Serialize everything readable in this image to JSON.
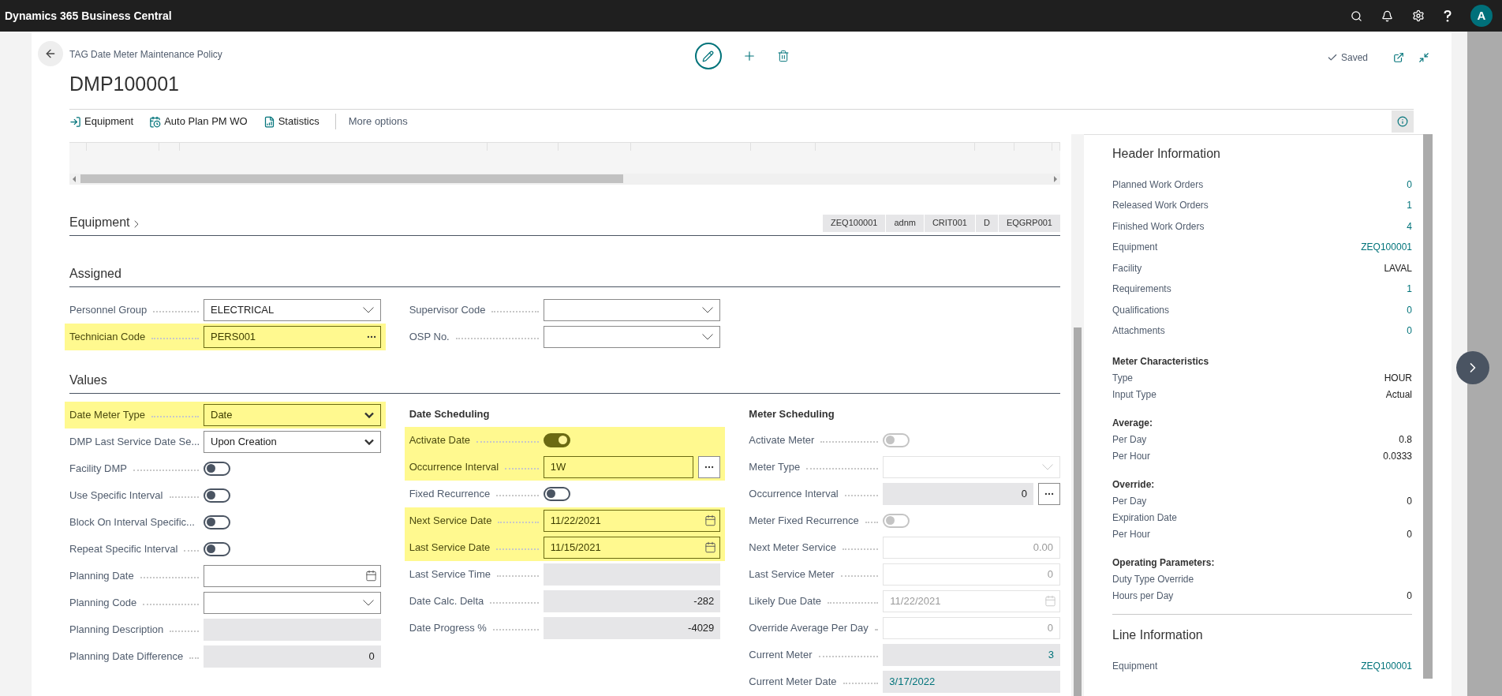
{
  "app_bar": {
    "title": "Dynamics 365 Business Central",
    "avatar": "A"
  },
  "page": {
    "breadcrumb": "TAG Date Meter Maintenance Policy",
    "title": "DMP100001",
    "status": "Saved"
  },
  "actions": [
    {
      "label": "Equipment",
      "kind": "equipment"
    },
    {
      "label": "Auto Plan PM WO",
      "kind": "plan"
    },
    {
      "label": "Statistics",
      "kind": "statistics"
    },
    {
      "label": "More options",
      "kind": "more"
    }
  ],
  "equipment_section": {
    "title": "Equipment",
    "tags": [
      "ZEQ100001",
      "adnm",
      "CRIT001",
      "D",
      "EQGRP001"
    ]
  },
  "assigned": {
    "title": "Assigned",
    "columns": [
      {
        "fields": [
          {
            "label": "Personnel Group",
            "kind": "combo",
            "value": "ELECTRICAL",
            "highlighted": false,
            "disabled": false
          },
          {
            "label": "Technician Code",
            "kind": "lookup",
            "value": "PERS001",
            "highlighted": true,
            "disabled": false
          }
        ]
      },
      {
        "fields": [
          {
            "label": "Supervisor Code",
            "kind": "combo",
            "highlighted": false,
            "disabled": false
          },
          {
            "label": "OSP No.",
            "kind": "combo",
            "highlighted": false,
            "disabled": false
          }
        ]
      }
    ]
  },
  "values": {
    "title": "Values",
    "columns": [
      {
        "fields": [
          {
            "label": "Date Meter Type",
            "kind": "select",
            "value": "Date",
            "highlighted": true,
            "disabled": false
          },
          {
            "label": "DMP Last Service Date Se...",
            "kind": "select",
            "value": "Upon Creation",
            "highlighted": false,
            "disabled": false
          },
          {
            "label": "Facility DMP",
            "kind": "toggle",
            "on": false,
            "highlighted": false,
            "disabled": false
          },
          {
            "label": "Use Specific Interval",
            "kind": "toggle",
            "on": false,
            "highlighted": false,
            "disabled": false
          },
          {
            "label": "Block On Interval Specific...",
            "kind": "toggle",
            "on": false,
            "highlighted": false,
            "disabled": false
          },
          {
            "label": "Repeat Specific Interval",
            "kind": "toggle",
            "on": false,
            "highlighted": false,
            "disabled": false
          },
          {
            "label": "Planning Date",
            "kind": "date",
            "highlighted": false,
            "disabled": false
          },
          {
            "label": "Planning Code",
            "kind": "combo",
            "highlighted": false,
            "disabled": false
          },
          {
            "label": "Planning Description",
            "kind": "readonly",
            "highlighted": false,
            "disabled": false
          },
          {
            "label": "Planning Date Difference",
            "kind": "number",
            "value": "0",
            "highlighted": false,
            "disabled": false
          }
        ]
      },
      {
        "heading": "Date Scheduling",
        "fields": [
          {
            "label": "Activate Date",
            "kind": "toggle",
            "on": true,
            "highlighted": true,
            "disabled": false
          },
          {
            "label": "Occurrence Interval",
            "kind": "text",
            "value": "1W",
            "more_button": true,
            "highlighted": true,
            "disabled": false
          },
          {
            "label": "Fixed Recurrence",
            "kind": "toggle",
            "on": false,
            "highlighted": false,
            "disabled": false
          },
          {
            "label": "Next Service Date",
            "kind": "date",
            "value": "11/22/2021",
            "highlighted": true,
            "disabled": false
          },
          {
            "label": "Last Service Date",
            "kind": "date",
            "value": "11/15/2021",
            "highlighted": true,
            "disabled": false
          },
          {
            "label": "Last Service Time",
            "kind": "readonly",
            "highlighted": false,
            "disabled": false
          },
          {
            "label": "Date Calc. Delta",
            "kind": "number",
            "value": "-282",
            "highlighted": false,
            "disabled": false
          },
          {
            "label": "Date Progress %",
            "kind": "number",
            "value": "-4029",
            "highlighted": false,
            "disabled": false
          }
        ]
      },
      {
        "heading": "Meter Scheduling",
        "fields": [
          {
            "label": "Activate Meter",
            "kind": "toggle",
            "on": false,
            "highlighted": false,
            "disabled": true
          },
          {
            "label": "Meter Type",
            "kind": "combo",
            "highlighted": false,
            "disabled": true
          },
          {
            "label": "Occurrence Interval",
            "kind": "number",
            "value": "0",
            "more_button": true,
            "highlighted": false,
            "disabled": false
          },
          {
            "label": "Meter Fixed Recurrence",
            "kind": "toggle",
            "on": false,
            "highlighted": false,
            "disabled": true
          },
          {
            "label": "Next Meter Service",
            "kind": "number",
            "value": "0.00",
            "highlighted": false,
            "disabled": true
          },
          {
            "label": "Last Service Meter",
            "kind": "number",
            "value": "0",
            "highlighted": false,
            "disabled": true
          },
          {
            "label": "Likely Due Date",
            "kind": "date",
            "value": "11/22/2021",
            "highlighted": false,
            "disabled": true
          },
          {
            "label": "Override Average Per Day",
            "kind": "number",
            "value": "0",
            "highlighted": false,
            "disabled": true
          },
          {
            "label": "Current Meter",
            "kind": "number",
            "value": "3",
            "link": true,
            "highlighted": false,
            "disabled": false
          },
          {
            "label": "Current Meter Date",
            "kind": "readonly",
            "value": "3/17/2022",
            "link": true,
            "highlighted": false,
            "disabled": false
          }
        ]
      }
    ]
  },
  "factbox": {
    "sections": [
      {
        "kind": "group",
        "title": "Header Information",
        "rows": [
          {
            "label": "Planned Work Orders",
            "value": "0",
            "link": true
          },
          {
            "label": "Released Work Orders",
            "value": "1",
            "link": true
          },
          {
            "label": "Finished Work Orders",
            "value": "4",
            "link": true
          },
          {
            "label": "Equipment",
            "value": "ZEQ100001",
            "link": true
          },
          {
            "label": "Facility",
            "value": "LAVAL",
            "link": false
          },
          {
            "label": "Requirements",
            "value": "1",
            "link": true
          },
          {
            "label": "Qualifications",
            "value": "0",
            "link": true
          },
          {
            "label": "Attachments",
            "value": "0",
            "link": true
          }
        ]
      },
      {
        "kind": "subgroup",
        "title": "Meter Characteristics",
        "rows": [
          {
            "label": "Type",
            "value": "HOUR",
            "link": false
          },
          {
            "label": "Input Type",
            "value": "Actual",
            "link": false
          }
        ]
      },
      {
        "kind": "subgroup",
        "title": "Average:",
        "rows": [
          {
            "label": "Per Day",
            "value": "0.8",
            "link": false
          },
          {
            "label": "Per Hour",
            "value": "0.0333",
            "link": false
          }
        ]
      },
      {
        "kind": "subgroup",
        "title": "Override:",
        "rows": [
          {
            "label": "Per Day",
            "value": "0",
            "link": false
          },
          {
            "label": "Expiration Date"
          },
          {
            "label": "Per Hour",
            "value": "0",
            "link": false
          }
        ]
      },
      {
        "kind": "subgroup",
        "title": "Operating Parameters:",
        "rows": [
          {
            "label": "Duty Type Override"
          },
          {
            "label": "Hours per Day",
            "value": "0",
            "link": false
          }
        ]
      },
      {
        "kind": "group",
        "title": "Line Information",
        "rows": [
          {
            "label": "Equipment",
            "value": "ZEQ100001",
            "link": true
          }
        ]
      }
    ]
  }
}
